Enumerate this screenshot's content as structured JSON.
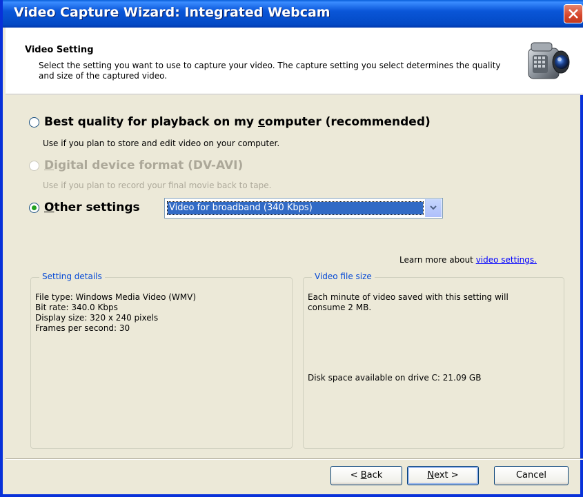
{
  "window": {
    "title": "Video Capture Wizard: Integrated Webcam",
    "close_icon": "close-icon"
  },
  "header": {
    "title": "Video Setting",
    "description": "Select the setting you want to use to capture your video. The capture setting you select determines the quality and size of the captured video.",
    "icon": "video-camera-icon"
  },
  "options": [
    {
      "label_pre": "Best quality for playback on my ",
      "label_accel": "c",
      "label_post": "omputer (recommended)",
      "description": "Use if you plan to store and edit video on your computer.",
      "selected": false,
      "enabled": true
    },
    {
      "label_pre": "",
      "label_accel": "D",
      "label_post": "igital device format (DV-AVI)",
      "description": "Use if you plan to record your final movie back to tape.",
      "selected": false,
      "enabled": false
    },
    {
      "label_pre": "",
      "label_accel": "O",
      "label_post": "ther settings",
      "selected": true,
      "enabled": true
    }
  ],
  "settings_select": {
    "value": "Video for broadband (340 Kbps)"
  },
  "learn_more": {
    "prefix": "Learn more about ",
    "link": "video settings."
  },
  "setting_details": {
    "title": "Setting details",
    "lines": [
      "File type: Windows Media Video (WMV)",
      "Bit rate: 340.0 Kbps",
      "Display size: 320 x 240 pixels",
      "Frames per second: 30"
    ]
  },
  "video_file_size": {
    "title": "Video file size",
    "line1": "Each minute of video saved with this setting  will",
    "line2": "consume 2 MB.",
    "disk_space": "Disk space available on drive C: 21.09 GB"
  },
  "buttons": {
    "back_pre": "< ",
    "back_accel": "B",
    "back_post": "ack",
    "next_accel": "N",
    "next_post": "ext >",
    "cancel": "Cancel"
  },
  "colors": {
    "titlebar": "#0a56d8",
    "radio_selected": "#21a121",
    "group_title": "#0046d5",
    "link": "#0000ff"
  }
}
